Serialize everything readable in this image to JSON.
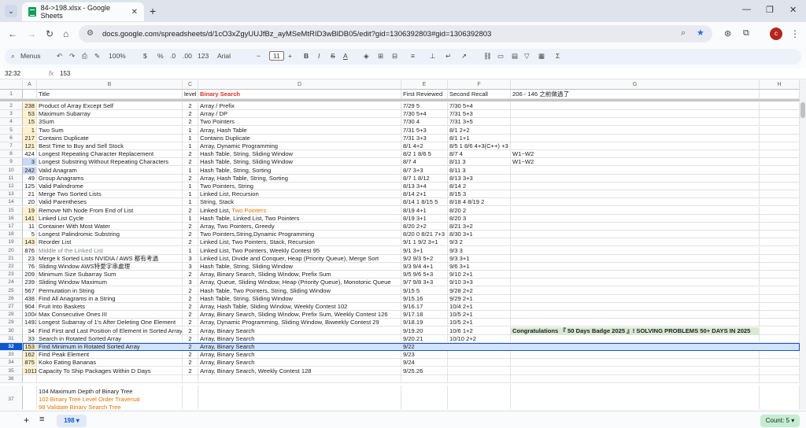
{
  "browser": {
    "tab_title": "84->198.xlsx - Google Sheets",
    "url": "docs.google.com/spreadsheets/d/1cO3xZgyUUJfBz_ayMSeMtRID3wBlDB05/edit?gid=1306392803#gid=1306392803",
    "avatar_letter": "c"
  },
  "toolbar": {
    "menus": "Menus",
    "zoom": "100%",
    "font": "Arial",
    "font_size": "11",
    "percent": "%",
    "currency": "$",
    "dec_dec": ".0",
    "dec_inc": ".00",
    "number_fmt": "123",
    "bold": "B",
    "italic": "I",
    "strike": "S",
    "textcolor": "A",
    "sigma": "Σ"
  },
  "formula_bar": {
    "cell_ref": "32:32",
    "fx": "fx",
    "value": "153"
  },
  "columns": [
    "A",
    "B",
    "C",
    "D",
    "E",
    "F",
    "G",
    "H"
  ],
  "header_row": {
    "b": "Title",
    "c": "level",
    "d": "Binary Search",
    "e": "First Reviewed",
    "f": "Second Recall",
    "g": "206 - 146 之前做過了"
  },
  "rows": [
    {
      "n": "2",
      "a": "238",
      "b": "Product of Array Except Self",
      "c": "2",
      "d": "Array / Prefix",
      "e": "7/29 5",
      "f": "7/30 5+4",
      "g": ""
    },
    {
      "n": "3",
      "a": "53",
      "b": "Maximum Subarray",
      "c": "2",
      "d": "Array / DP",
      "e": "7/30 5+4",
      "f": "7/31 5+3",
      "g": ""
    },
    {
      "n": "4",
      "a": "15",
      "b": "3Sum",
      "c": "2",
      "d": "Two Pointers",
      "e": "7/30 4",
      "f": "7/31 3+5",
      "g": ""
    },
    {
      "n": "5",
      "a": "1",
      "b": "Two Sum",
      "c": "1",
      "d": "Array, Hash Table",
      "e": "7/31 5+3",
      "f": "8/1 2+2",
      "g": ""
    },
    {
      "n": "6",
      "a": "217",
      "b": "Contains Duplicate",
      "c": "1",
      "d": "Contains Duplicate",
      "e": "7/31 3+3",
      "f": "8/1 1+1",
      "g": ""
    },
    {
      "n": "7",
      "a": "121",
      "b": "Best Time to Buy and Sell Stock",
      "c": "1",
      "d": "Array, Dynamic Programming",
      "e": "8/1 4+2",
      "f": "8/5 1 8/6 4+3(C++) +3",
      "g": ""
    },
    {
      "n": "8",
      "a": "424",
      "b": "Longest Repeating Character Replacement",
      "c": "2",
      "d": "Hash Table, String, Sliding Window",
      "e": "8/2 1 8/6 5",
      "f": "8/7 4",
      "g": "W1~W2"
    },
    {
      "n": "9",
      "a": "3",
      "b": "Longest Substring Without Repeating Characters",
      "c": "2",
      "d": "Hash Table, String, Sliding Window",
      "e": "8/7 4",
      "f": "8/11 3",
      "g": "W1~W2"
    },
    {
      "n": "10",
      "a": "242",
      "b": "Valid Anagram",
      "c": "1",
      "d": "Hash Table, String, Sorting",
      "e": "8/7 3+3",
      "f": "8/11 3",
      "g": ""
    },
    {
      "n": "11",
      "a": "49",
      "b": "Group Anagrams",
      "c": "2",
      "d": "Array, Hash Table, String, Sorting",
      "e": "8/7 1 8/12",
      "f": "8/13 3+3",
      "g": ""
    },
    {
      "n": "12",
      "a": "125",
      "b": "Valid Palindrome",
      "c": "1",
      "d": "Two Pointers, String",
      "e": "8/13 3+4",
      "f": "8/14 2",
      "g": ""
    },
    {
      "n": "13",
      "a": "21",
      "b": "Merge Two Sorted Lists",
      "c": "1",
      "d": "Linked List, Recursion",
      "e": "8/14 2+1",
      "f": "8/15 3",
      "g": ""
    },
    {
      "n": "14",
      "a": "20",
      "b": "Valid Parentheses",
      "c": "1",
      "d": "String, Stack",
      "e": "8/14 1 8/15 5",
      "f": "8/18 4 8/19 2",
      "g": ""
    },
    {
      "n": "15",
      "a": "19",
      "b": "Remove Nth Node From End of List",
      "c": "2",
      "d": "Linked List, ",
      "d2": "Two Pointers",
      "e": "8/19 4+1",
      "f": "8/20 2",
      "g": ""
    },
    {
      "n": "16",
      "a": "141",
      "b": "Linked List Cycle",
      "c": "1",
      "d": "Hash Table, Linked List, Two Pointers",
      "e": "8/19 3+1",
      "f": "8/20 3",
      "g": ""
    },
    {
      "n": "17",
      "a": "11",
      "b": "Container With Most Water",
      "c": "2",
      "d": "Array, Two Pointers, Greedy",
      "e": "8/20 2+2",
      "f": "8/21 3+2",
      "g": ""
    },
    {
      "n": "18",
      "a": "5",
      "b": "Longest Palindromic Substring",
      "c": "2",
      "d": "Two Pointers,String,Dynamic Programming",
      "e": "8/20 0 8/21 7+3",
      "f": "8/30 3+1",
      "g": ""
    },
    {
      "n": "19",
      "a": "143",
      "b": "Reorder List",
      "c": "2",
      "d": "Linked List, Two Pointers, Stack, Recursion",
      "e": "9/1 1 9/2 3+1",
      "f": "9/3 2",
      "g": ""
    },
    {
      "n": "20",
      "a": "876",
      "b": "Middle of the Linked List",
      "c": "1",
      "d": "Linked List, Two Pointers, Weekly Contest 95",
      "e": "9/1 3+1",
      "f": "9/3 3",
      "g": ""
    },
    {
      "n": "21",
      "a": "23",
      "b": " Merge k Sorted Lists NVIDIA / AWS 都有考過",
      "c": "3",
      "d": "Linked List, Divide and Conquer, Heap (Priority Queue), Merge Sort",
      "e": "9/2 9/3 5+2",
      "f": "9/3 3+1",
      "g": ""
    },
    {
      "n": "22",
      "a": "76",
      "b": "Sliding Window AWS特愛字串處理",
      "c": "3",
      "d": "Hash Table, String, Sliding Window",
      "e": "9/3 9/4 4+1",
      "f": "9/6 3+1",
      "g": ""
    },
    {
      "n": "23",
      "a": "209",
      "b": "Minimum Size Subarray Sum",
      "c": "2",
      "d": "Array, Binary Search, Sliding Window, Prefix Sum",
      "e": "9/5 9/6 5+3",
      "f": "9/10 2+1",
      "g": ""
    },
    {
      "n": "24",
      "a": "239",
      "b": "Sliding Window Maximum",
      "c": "3",
      "d": "Array, Queue, Sliding Window, Heap (Priority Queue), Monotonic Queue",
      "e": "9/7 9/8 3+3",
      "f": "9/10 3+3",
      "g": ""
    },
    {
      "n": "25",
      "a": "567",
      "b": "Permutation in String",
      "c": "2",
      "d": "Hash Table, Two Pointers, String, Sliding Window",
      "e": "9/15 5",
      "f": "9/28 2+2",
      "g": ""
    },
    {
      "n": "26",
      "a": "438",
      "b": "Find All Anagrams in a String",
      "c": "2",
      "d": "Hash Table, String, Sliding Window",
      "e": "9/15.16",
      "f": "9/29 2+1",
      "g": ""
    },
    {
      "n": "27",
      "a": "904",
      "b": "Fruit Into Baskets",
      "c": "2",
      "d": "Array, Hash Table, Sliding Window, Weekly Contest 102",
      "e": "9/16.17",
      "f": "10/4 2+1",
      "g": ""
    },
    {
      "n": "28",
      "a": "1004",
      "b": "Max Consecutive Ones III",
      "c": "2",
      "d": "Array, Binary Search, Sliding Window, Prefix Sum, Weekly Contest 126",
      "e": "9/17.18",
      "f": "10/5 2+1",
      "g": ""
    },
    {
      "n": "29",
      "a": "1493",
      "b": "Longest Subarray of 1's After Deleting One Element",
      "c": "2",
      "d": "Array, Dynamic Programming, Sliding Window, Biweekly Contest 29",
      "e": "9/18.19",
      "f": "10/5 2+1",
      "g": ""
    },
    {
      "n": "30",
      "a": "34",
      "b": "Find First and Last Position of Element in Sorted Array",
      "c": "2",
      "d": "Array, Binary Search",
      "e": "9/19.20",
      "f": "10/6 1+2",
      "g": "Congratulations 『 50 Days Badge 2025 』! SOLVING PROBLEMS 50+ DAYS IN 2025"
    },
    {
      "n": "31",
      "a": "33",
      "b": "Search in Rotated Sorted Array",
      "c": "2",
      "d": "Array, Binary Search",
      "e": "9/20.21",
      "f": "10/10 2+2",
      "g": ""
    },
    {
      "n": "32",
      "a": "153",
      "b": "Find Minimum in Rotated Sorted Array",
      "c": "2",
      "d": "Array, Binary Search",
      "e": "9/22",
      "f": "",
      "g": ""
    },
    {
      "n": "33",
      "a": "162",
      "b": "Find Peak Element",
      "c": "2",
      "d": "Array, Binary Search",
      "e": "9/23",
      "f": "",
      "g": ""
    },
    {
      "n": "34",
      "a": "875",
      "b": "Koko Eating Bananas",
      "c": "2",
      "d": "Array, Binary Search",
      "e": "9/24",
      "f": "",
      "g": ""
    },
    {
      "n": "35",
      "a": "1011",
      "b": "Capacity To Ship Packages Within D Days",
      "c": "2",
      "d": "Array, Binary Search, Weekly Contest 128",
      "e": "9/25.26",
      "f": "",
      "g": ""
    },
    {
      "n": "36",
      "a": "",
      "b": "",
      "c": "",
      "d": "",
      "e": "",
      "f": "",
      "g": ""
    }
  ],
  "row37": {
    "n": "37",
    "line1": "104 Maximum Depth of Binary Tree",
    "line2": "102 Binary Tree Level Order Traversal",
    "line3": "98 Validate Binary Search Tree"
  },
  "bottom": {
    "sheet": "198",
    "count": "Count: 5"
  },
  "colors": {
    "a_highlight": "#fde9b8",
    "a_highlight_blue": "#c9daf8",
    "accent_red": "#d93025",
    "orange": "#e37400",
    "gray": "#80868b",
    "congrats_bg": "#d9ead3"
  }
}
